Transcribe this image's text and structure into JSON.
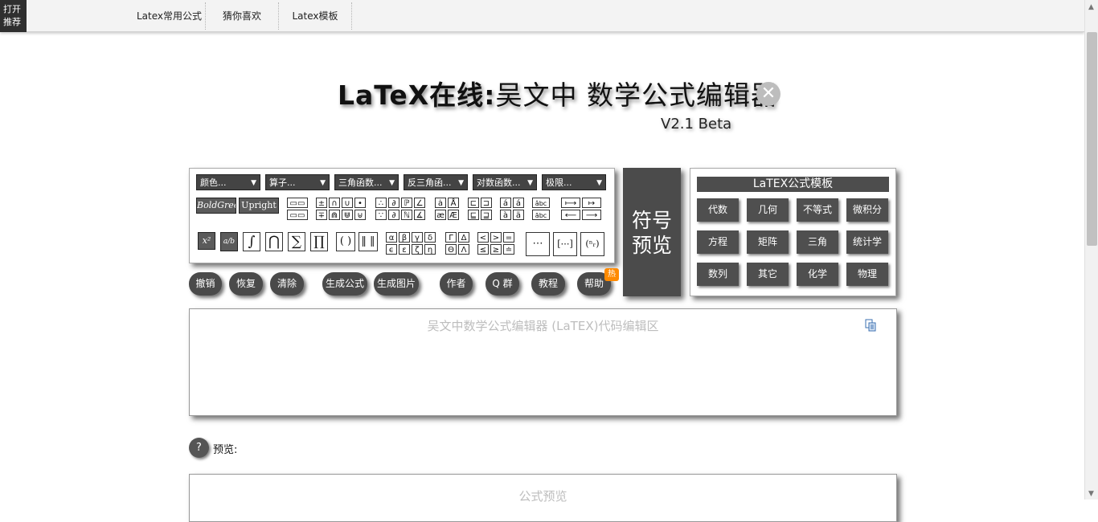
{
  "nav": {
    "open_recommend": [
      "打开",
      "推荐"
    ],
    "items": [
      "Latex常用公式",
      "猜你喜欢",
      "Latex模板"
    ]
  },
  "header": {
    "title_bold": "LaTeX在线:",
    "title_thin": "吴文中 数学公式编辑器",
    "version": "V2.1 Beta",
    "close_symbol": "✕"
  },
  "dropdowns": [
    "颜色...",
    "算子...",
    "三角函数...",
    "反三角函...",
    "对数函数...",
    "极限..."
  ],
  "font_buttons": [
    "BoldGreek",
    "Upright"
  ],
  "symbols": {
    "sup": "x²",
    "frac": "a/b",
    "integral": "∫",
    "bigcap": "⋂",
    "sum": "∑",
    "prod": "∏",
    "parens": "( )",
    "norm": "‖ ‖",
    "dots_h": "⋯",
    "matrix": "[⋯]",
    "binom": "(ⁿᵣ)",
    "grid_ops": [
      "±",
      "∩",
      "∪",
      "•",
      "∓",
      "⋒",
      "⋓",
      "⊎"
    ],
    "grid_b": [
      "∴",
      "∂",
      "ℙ",
      "∠",
      "∵",
      "∂",
      "ℕ",
      "∡"
    ],
    "grid_c": [
      "ȧ",
      "Å",
      "æ",
      "Æ"
    ],
    "grid_d": [
      "⊏",
      "⊐",
      "⊑",
      "⊒"
    ],
    "grid_e": [
      "á",
      "á",
      "à",
      "ä"
    ],
    "grid_f": [
      "âbc",
      "ãbc"
    ],
    "grid_arrows": [
      "⟼",
      "↦",
      "⟵",
      "⟶"
    ],
    "grid_greek": [
      "α",
      "β",
      "γ",
      "δ",
      "ϵ",
      "ε",
      "ζ",
      "η"
    ],
    "grid_greek_cap": [
      "Γ",
      "Δ",
      "Θ",
      "Λ"
    ],
    "grid_rel": [
      "<",
      ">",
      "=",
      "≤",
      "≥",
      "≐"
    ]
  },
  "actions": [
    "撤销",
    "恢复",
    "清除",
    "生成公式",
    "生成图片",
    "作者",
    "Q 群",
    "教程",
    "帮助"
  ],
  "hot_badge": "热",
  "symbol_preview": [
    "符号",
    "预览"
  ],
  "templates": {
    "title": "LaTEX公式模板",
    "items": [
      "代数",
      "几何",
      "不等式",
      "微积分",
      "方程",
      "矩阵",
      "三角",
      "统计学",
      "数列",
      "其它",
      "化学",
      "物理"
    ]
  },
  "editor": {
    "placeholder": "吴文中数学公式编辑器 (LaTEX)代码编辑区"
  },
  "preview": {
    "help_symbol": "?",
    "label": "预览:",
    "placeholder": "公式预览"
  }
}
